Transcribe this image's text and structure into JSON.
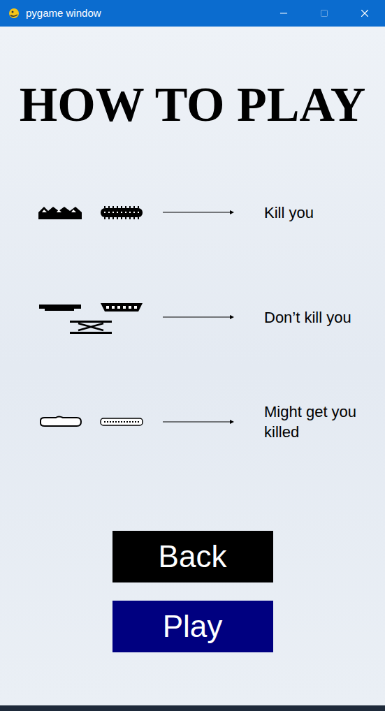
{
  "window": {
    "title": "pygame window",
    "controls": [
      {
        "kind": "minimize",
        "disabled": false
      },
      {
        "kind": "maximize",
        "disabled": true
      },
      {
        "kind": "close",
        "disabled": false
      }
    ]
  },
  "heading": "HOW TO PLAY",
  "rows": [
    {
      "label": "Kill you",
      "items": [
        {
          "kind": "spikes"
        },
        {
          "kind": "spiked-log"
        }
      ]
    },
    {
      "label": "Don’t kill you",
      "items": [
        {
          "kind": "platform"
        },
        {
          "kind": "bowl"
        },
        {
          "kind": "spring"
        }
      ]
    },
    {
      "label": "Might get you killed",
      "items": [
        {
          "kind": "cloud"
        },
        {
          "kind": "dotted"
        }
      ]
    }
  ],
  "buttons": [
    {
      "label": "Back",
      "color": "#000000"
    },
    {
      "label": "Play",
      "color": "#000080"
    }
  ]
}
